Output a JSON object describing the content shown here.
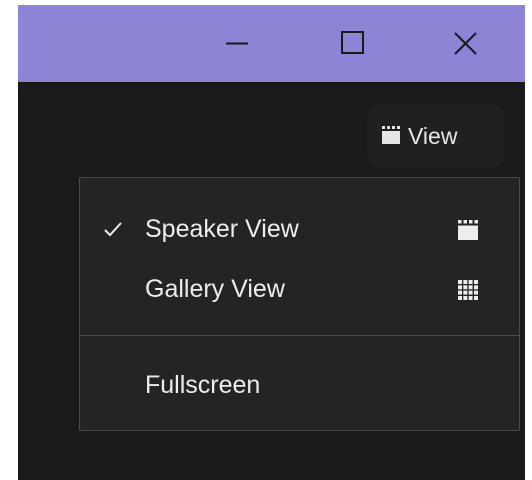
{
  "window": {
    "titlebar_color": "#8c85d6",
    "background_color": "#1a1a1a",
    "controls": [
      {
        "name": "minimize",
        "icon": "minimize-icon"
      },
      {
        "name": "maximize",
        "icon": "maximize-icon"
      },
      {
        "name": "close",
        "icon": "close-icon"
      }
    ]
  },
  "view_button": {
    "label": "View",
    "icon": "speaker-view-icon"
  },
  "menu": {
    "items": [
      {
        "label": "Speaker View",
        "checked": true,
        "icon": "speaker-view-icon"
      },
      {
        "label": "Gallery View",
        "checked": false,
        "icon": "gallery-grid-icon"
      },
      {
        "label": "Fullscreen",
        "checked": false,
        "icon": ""
      }
    ]
  }
}
